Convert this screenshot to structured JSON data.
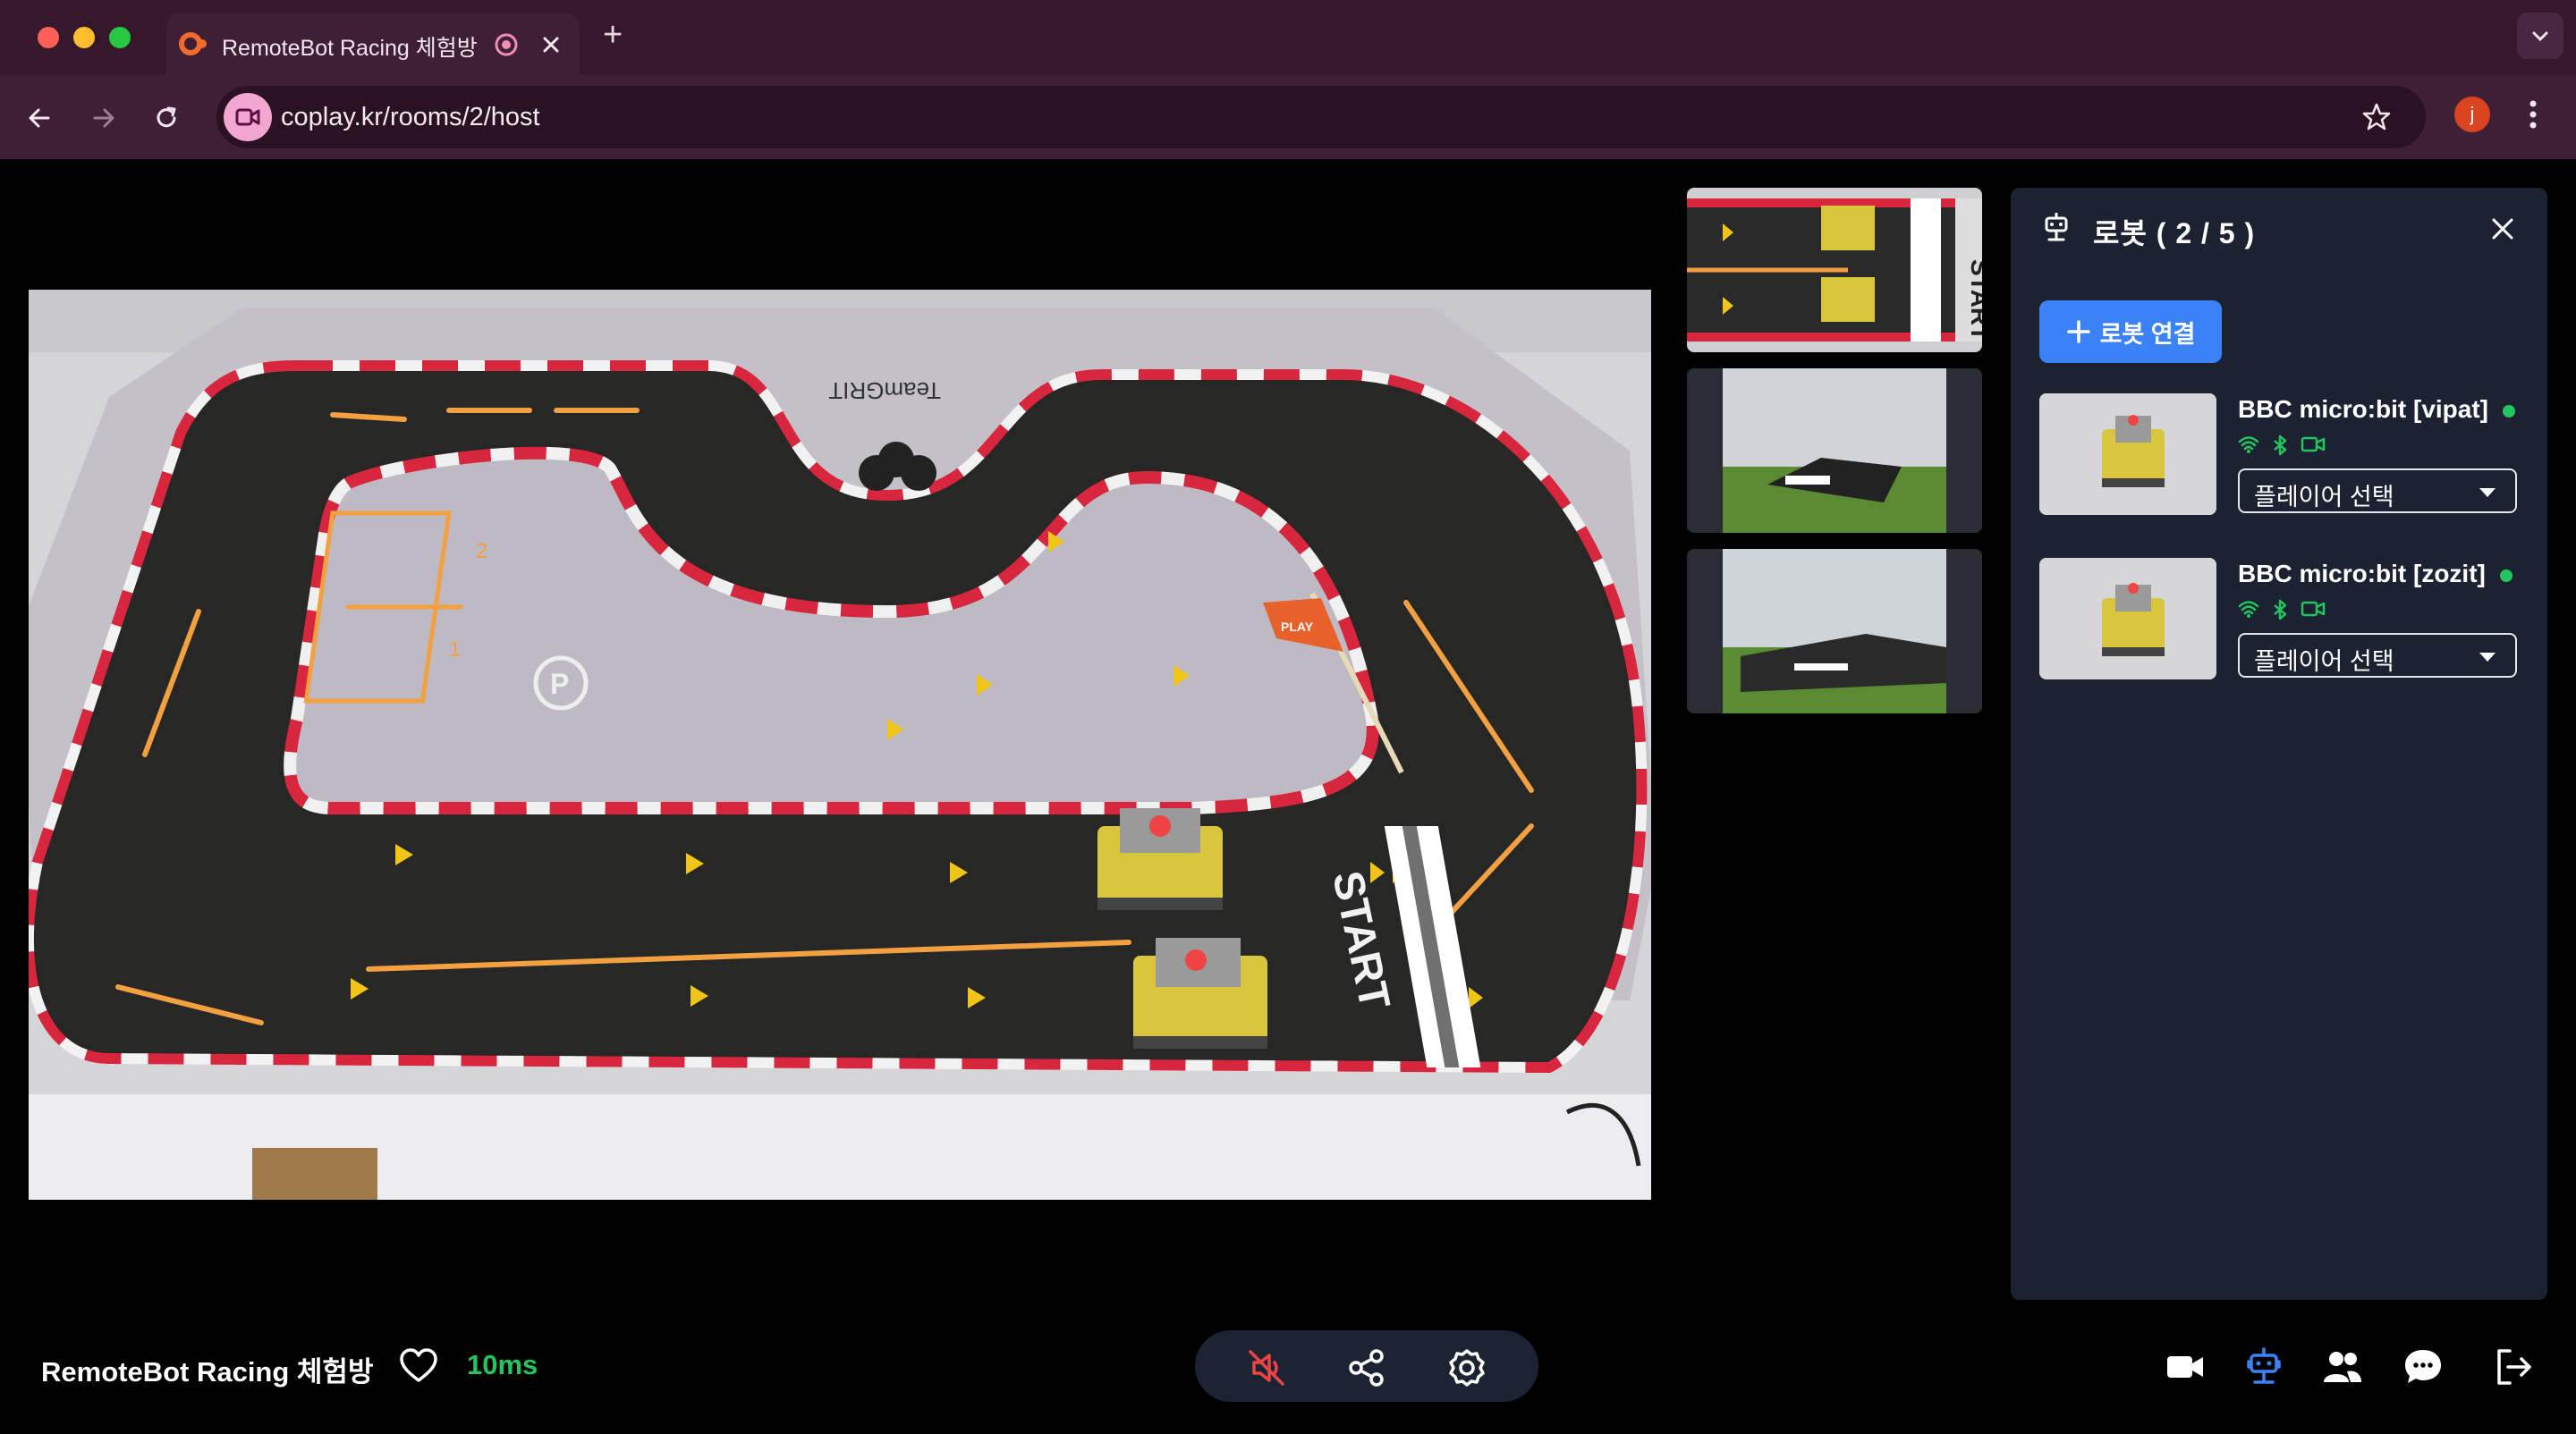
{
  "browser": {
    "tab_title": "RemoteBot Racing 체험방",
    "new_tab": "+",
    "url": "coplay.kr/rooms/2/host",
    "profile_initial": "j"
  },
  "video": {
    "track_label": "TeamGRIT",
    "start_label": "START",
    "thumb_start_label": "START",
    "flag_label": "PLAY",
    "zone_1": "1",
    "zone_2": "2",
    "parking": "P"
  },
  "robot_panel": {
    "title": "로봇 ( 2 / 5 )",
    "connect_button": "로봇 연결",
    "robots": [
      {
        "name": "BBC micro:bit [vipat]",
        "status": "online",
        "select_value": "플레이어 선택"
      },
      {
        "name": "BBC micro:bit [zozit]",
        "status": "online",
        "select_value": "플레이어 선택"
      }
    ]
  },
  "footer": {
    "room_title": "RemoteBot Racing 체험방",
    "latency": "10ms"
  },
  "colors": {
    "tab_bar": "#35182c",
    "toolbar": "#3f1f35",
    "panel_bg": "#1c2231",
    "accent": "#3b82f6",
    "online": "#22c55e",
    "mute_red": "#ef4444",
    "active_icon": "#3b82f6"
  },
  "icons": [
    "close-window",
    "minimize-window",
    "maximize-window",
    "site-favicon",
    "record-icon",
    "close-icon",
    "plus-icon",
    "chevron-down-icon",
    "back-icon",
    "forward-icon",
    "reload-icon",
    "site-info-icon",
    "star-icon",
    "kebab-menu-icon",
    "robot-icon",
    "wifi-icon",
    "bluetooth-icon",
    "camera-icon",
    "heart-icon",
    "speaker-muted-icon",
    "share-icon",
    "settings-icon",
    "video-camera-icon",
    "robot-active-icon",
    "users-icon",
    "chat-icon",
    "exit-icon"
  ]
}
